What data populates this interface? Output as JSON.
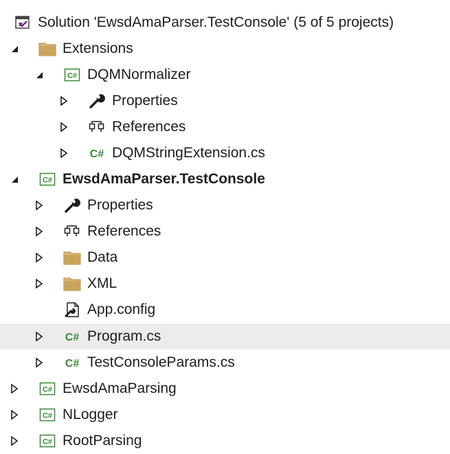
{
  "solution": {
    "label": "Solution 'EwsdAmaParser.TestConsole' (5 of 5 projects)"
  },
  "nodes": {
    "extensions": "Extensions",
    "dqm_project": "DQMNormalizer",
    "dqm_properties": "Properties",
    "dqm_references": "References",
    "dqm_string_ext": "DQMStringExtension.cs",
    "test_console": "EwsdAmaParser.TestConsole",
    "tc_properties": "Properties",
    "tc_references": "References",
    "tc_data": "Data",
    "tc_xml": "XML",
    "tc_app_config": "App.config",
    "tc_program": "Program.cs",
    "tc_params": "TestConsoleParams.cs",
    "ewsd_parsing": "EwsdAmaParsing",
    "nlogger": "NLogger",
    "root_parsing": "RootParsing"
  },
  "colors": {
    "csharp_green": "#388a34",
    "folder_tan": "#c9a45c",
    "folder_tan_dark": "#b08a43",
    "vs_purple": "#68217a",
    "selected_row": "#ececec",
    "text": "#1e1e1e"
  }
}
